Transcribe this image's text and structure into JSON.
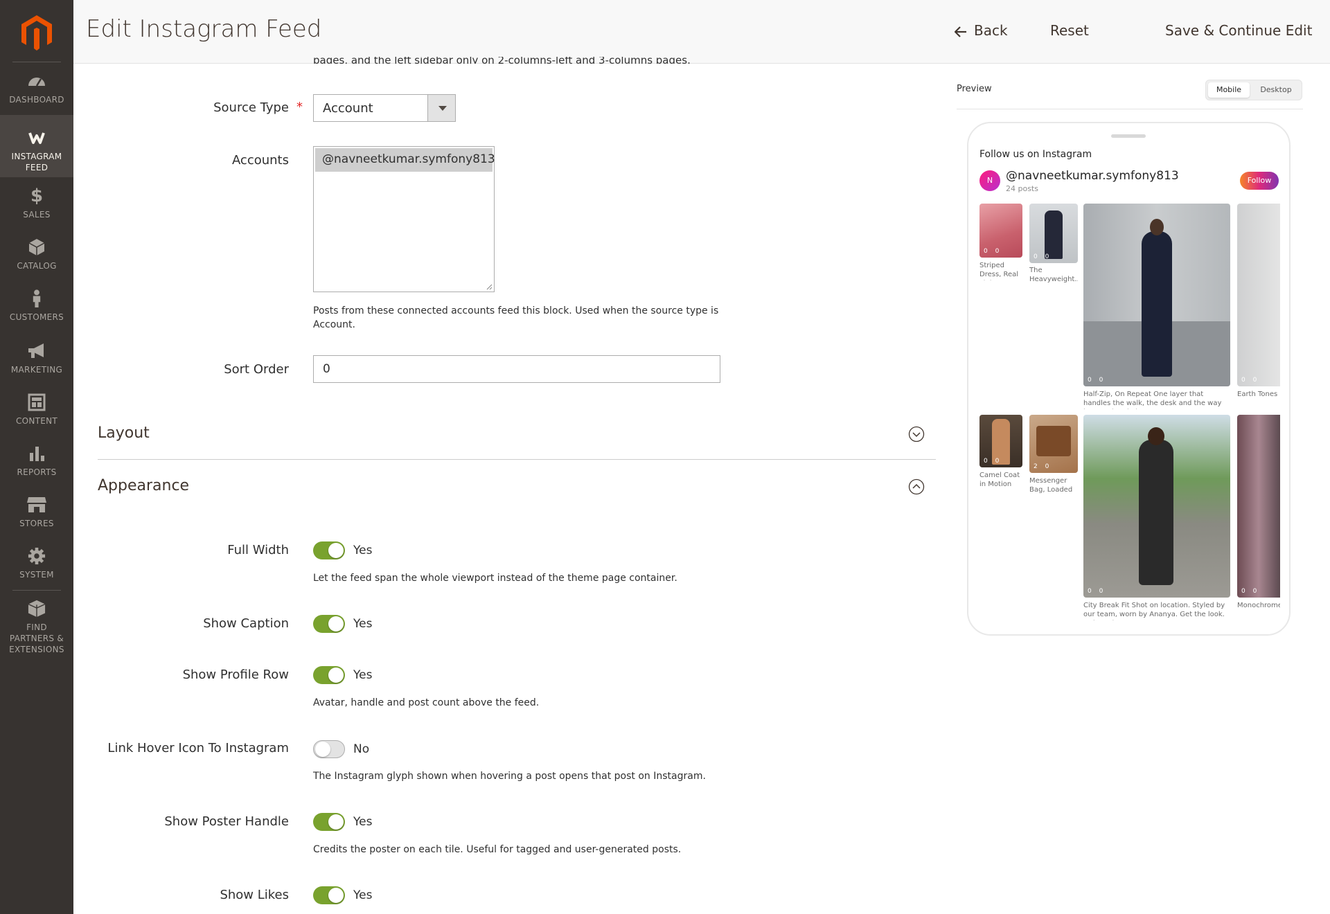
{
  "sidebar": {
    "items": [
      {
        "label": "DASHBOARD",
        "icon": "dashboard-icon"
      },
      {
        "label": "INSTAGRAM FEED",
        "icon": "instagram-feed-icon",
        "active": true
      },
      {
        "label": "SALES",
        "icon": "dollar-icon"
      },
      {
        "label": "CATALOG",
        "icon": "cube-icon"
      },
      {
        "label": "CUSTOMERS",
        "icon": "person-icon"
      },
      {
        "label": "MARKETING",
        "icon": "megaphone-icon"
      },
      {
        "label": "CONTENT",
        "icon": "layout-icon"
      },
      {
        "label": "REPORTS",
        "icon": "bar-chart-icon"
      },
      {
        "label": "STORES",
        "icon": "storefront-icon"
      },
      {
        "label": "SYSTEM",
        "icon": "gear-icon"
      },
      {
        "label": "FIND PARTNERS & EXTENSIONS",
        "icon": "boxes-icon"
      }
    ]
  },
  "header": {
    "title": "Edit Instagram Feed",
    "back_label": "Back",
    "reset_label": "Reset",
    "save_label": "Save & Continue Edit"
  },
  "form": {
    "cutoff_text": "pages, and the left sidebar only on 2-columns-left and 3-columns pages.",
    "source_type": {
      "label": "Source Type",
      "value": "Account"
    },
    "accounts": {
      "label": "Accounts",
      "options": [
        "@navneetkumar.symfony813"
      ],
      "note": "Posts from these connected accounts feed this block. Used when the source type is Account."
    },
    "sort_order": {
      "label": "Sort Order",
      "value": "0"
    }
  },
  "sections": {
    "layout": "Layout",
    "appearance": "Appearance"
  },
  "appearance": {
    "full_width": {
      "label": "Full Width",
      "state": "Yes",
      "note": "Let the feed span the whole viewport instead of the theme page container."
    },
    "show_caption": {
      "label": "Show Caption",
      "state": "Yes"
    },
    "show_profile_row": {
      "label": "Show Profile Row",
      "state": "Yes",
      "note": "Avatar, handle and post count above the feed."
    },
    "link_hover_icon": {
      "label": "Link Hover Icon To Instagram",
      "state": "No",
      "note": "The Instagram glyph shown when hovering a post opens that post on Instagram."
    },
    "show_poster_handle": {
      "label": "Show Poster Handle",
      "state": "Yes",
      "note": "Credits the poster on each tile. Useful for tagged and user-generated posts."
    },
    "show_likes": {
      "label": "Show Likes",
      "state": "Yes"
    }
  },
  "preview": {
    "label": "Preview",
    "mobile": "Mobile",
    "desktop": "Desktop",
    "follow_title": "Follow us on Instagram",
    "avatar_initial": "N",
    "handle": "@navneetkumar.symfony813",
    "posts": "24 posts",
    "follow_button": "Follow",
    "tiles": [
      {
        "caption": "Striped Dress, Real Light N...",
        "stats": "0 0"
      },
      {
        "caption": "The Heavyweight...",
        "stats": "0 0"
      },
      {
        "caption": "Half-Zip, On Repeat One layer that handles the walk, the desk and the way home. Shop knitwe...",
        "stats": "0 0"
      },
      {
        "caption": "Earth Tones Br else needed. L",
        "stats": "0 0"
      },
      {
        "caption": "Camel Coat in Motion See...",
        "stats": "0 0"
      },
      {
        "caption": "Messenger Bag, Loaded Lapto...",
        "stats": "2 0"
      },
      {
        "caption": "City Break Fit Shot on location. Styled by our team, worn by Ananya. Get the look. #citystyle...",
        "stats": "0 0"
      },
      {
        "caption": "Monochrome done. Shop th",
        "stats": "0 0"
      }
    ]
  },
  "colors": {
    "sidebar_bg": "#373330",
    "accent_orange": "#eb5202",
    "toggle_on": "#79a22e",
    "required": "#e22626"
  }
}
